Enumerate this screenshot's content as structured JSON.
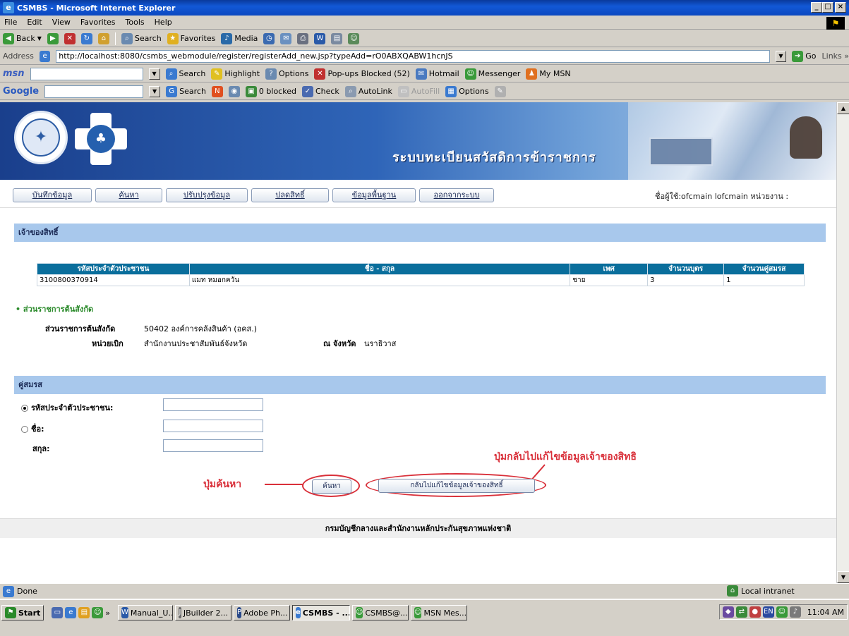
{
  "window": {
    "title": "CSMBS - Microsoft Internet Explorer",
    "min": "_",
    "max": "□",
    "close": "×"
  },
  "menu": [
    "File",
    "Edit",
    "View",
    "Favorites",
    "Tools",
    "Help"
  ],
  "toolbar": {
    "back": "Back",
    "search": "Search",
    "favorites": "Favorites",
    "media": "Media"
  },
  "address": {
    "label": "Address",
    "url": "http://localhost:8080/csmbs_webmodule/register/registerAdd_new.jsp?typeAdd=rO0ABXQABW1hcnJS",
    "go": "Go",
    "links": "Links »"
  },
  "msnbar": {
    "logo": "msn",
    "search": "Search",
    "highlight": "Highlight",
    "options": "Options",
    "popups": "Pop-ups Blocked (52)",
    "hotmail": "Hotmail",
    "messenger": "Messenger",
    "mymsn": "My MSN"
  },
  "googlebar": {
    "logo": "Google",
    "search": "Search",
    "blocked": "0 blocked",
    "check": "Check",
    "autolink": "AutoLink",
    "autofill": "AutoFill",
    "options": "Options"
  },
  "banner": {
    "title": "ระบบทะเบียนสวัสดิการข้าราชการ"
  },
  "nav": {
    "items": [
      "บันทึกข้อมูล",
      "ค้นหา",
      "ปรับปรุงข้อมูล",
      "ปลดสิทธิ์",
      "ข้อมูลพื้นฐาน",
      "ออกจากระบบ"
    ],
    "user": "ชื่อผู้ใช้:ofcmain lofcmain  หน่วยงาน :"
  },
  "owner": {
    "section_title": "เจ้าของสิทธิ์",
    "headers": [
      "รหัสประจำตัวประชาชน",
      "ชื่อ - สกุล",
      "เพศ",
      "จำนวนบุตร",
      "จำนวนคู่สมรส"
    ],
    "row": [
      "3100800370914",
      "แมท หมอกควัน",
      "ชาย",
      "3",
      "1"
    ]
  },
  "agency": {
    "heading": "ส่วนราชการต้นสังกัด",
    "label1": "ส่วนราชการต้นสังกัด",
    "value1": "50402 องค์การคลังสินค้า (อคส.)",
    "label2": "หน่วยเบิก",
    "value2": "สำนักงานประชาสัมพันธ์จังหวัด",
    "label3": "ณ จังหวัด",
    "value3": "นราธิวาส"
  },
  "spouse": {
    "section_title": "คู่สมรส",
    "id_label": "รหัสประจำตัวประชาชน:",
    "name_label": "ชื่อ:",
    "surname_label": "สกุล:",
    "id_value": "",
    "name_value": "",
    "surname_value": ""
  },
  "buttons": {
    "search": "ค้นหา",
    "back": "กลับไปแก้ไขข้อมูลเจ้าของสิทธิ์"
  },
  "annotations": {
    "search": "ปุ่มค้นหา",
    "back": "ปุ่มกลับไปแก้ไขข้อมูลเจ้าของสิทธิ"
  },
  "footer": "กรมบัญชีกลางและสำนักงานหลักประกันสุขภาพแห่งชาติ",
  "status": {
    "left": "Done",
    "zone": "Local intranet"
  },
  "taskbar": {
    "start": "Start",
    "tasks": [
      "Manual_U...",
      "JBuilder 2...",
      "Adobe Ph...",
      "CSMBS - ...",
      "CSMBS@...",
      "MSN Mes..."
    ],
    "clock": "11:04 AM"
  }
}
